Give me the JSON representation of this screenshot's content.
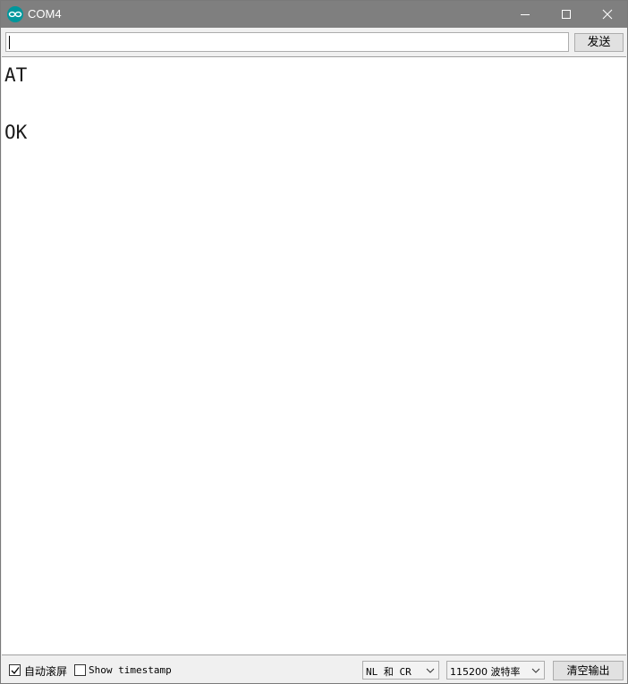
{
  "window": {
    "title": "COM4",
    "icon": "arduino-logo-icon",
    "controls": [
      "minimize-icon",
      "maximize-icon",
      "close-icon"
    ],
    "titlebar_color": "#7f7f7f"
  },
  "input": {
    "value": "",
    "send_label": "发送"
  },
  "output": {
    "lines": [
      "AT",
      "OK"
    ]
  },
  "statusbar": {
    "autoscroll_label": "自动滚屏",
    "autoscroll_checked": true,
    "timestamp_label": "Show timestamp",
    "timestamp_checked": false,
    "line_ending": "NL 和 CR",
    "baud_rate": "115200 波特率",
    "clear_label": "清空输出"
  },
  "colors": {
    "accent": "#00979c"
  }
}
